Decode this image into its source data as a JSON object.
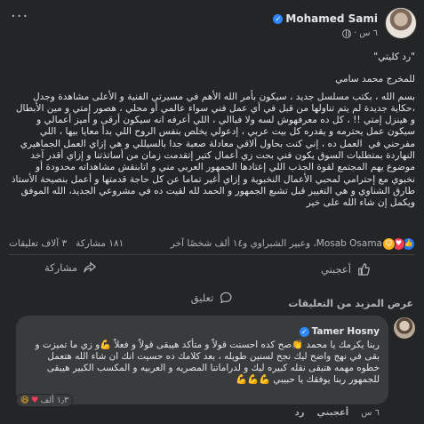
{
  "post": {
    "author": "Mohamed Sami",
    "time": "٦ س",
    "more": "···",
    "title_quote": "\"رد كليتي\"",
    "byline": "للمخرج محمد سامي",
    "body": "بسم الله ، بكتب مسلسل جديد ، سيكون بأمر الله الأهم في مسيرتي الفنية و الأعلى مشاهدة وجدل ،حكاية جديدة لم يتم تناولها من قبل في أي عمل فني سواء عالمي أو محلي ، هصور إمتي و مين الأبطال و هينزل إمتي !! ، كل ده معرفهوش لسه ولا فباالي ، اللي أعرفه انه سيكون أرقى و أميز أعمالي و سيكون عمل يحترمه و يقدره كل بيت عربي ، إدعولي يخلص بنفس الروح اللي بدأ معايا بيها ، اللي مفرحني في  العمل ده ، إني كنت بحاول ألاقي معادلة صعبة جدا بالسيللي و هي إزاي العمل الجماهيري النهاردة بمتطلبات السوق يكون فني بحت زي أعمال كتير إتقدمت زمان من أساتذتنا و إزاي أقدر آخد موضوع يهم المجتمع لقوة الجذب اللي إعتادها الجمهور العربي مني و اتابنقش مشاهداته محدودة أو نخبوي مع إحترامي لمحبي الأعمال النخبوية و إزاي أغير تماما عن كل حاجة قدمتها و أعمل بنصيحة الأستاذ طارق الشناوي و هي التغيير قبل تشبع الجمهور و الحمد لله لقيت ده في مشروعي الجديد، الله الموفق ويكمل إن شاء الله على خير"
  },
  "summary": {
    "reactors": "Mosab Osama، وعبير الشبراوي و١٤ ألف شخصًا آخر",
    "comments": "٣ آلاف تعليقات",
    "shares": "١٨١ مشاركة",
    "reaction_icons": [
      "like-icon",
      "love-icon",
      "care-icon"
    ]
  },
  "actions": {
    "like": "أعجبني",
    "comment": "تعليق",
    "share": "مشاركة"
  },
  "more_comments": "عرض المزيد من التعليقات",
  "comment": {
    "author": "Tamer Hosny",
    "text": "ربنا يكرمك يا محمد 👏صح كده احسنت قولاً و متأكد هيبقى قولاً و فعلاً 💪و زي ما تميزت و بقى في نهج واضح ليك نجح لسنين طويله ، بعد كلامك ده حسيت انك ان شاء الله هتعمل خطوه مهمه هتبقى نقله كبيره ليك و لدراماتنا المصريه و العربيه و المكسب الكبير هيبقى للجمهور ربنا يوفقك يا حبيبي 💪💪💪",
    "reaction_count": "١٫٣ ألف",
    "time": "٦ س",
    "like": "أعجبني",
    "reply": "رد"
  },
  "colors": {
    "background": "#242526",
    "text": "#e4e6eb",
    "muted": "#b0b3b8",
    "accent": "#2d88ff",
    "bubble": "#3a3b3c"
  }
}
